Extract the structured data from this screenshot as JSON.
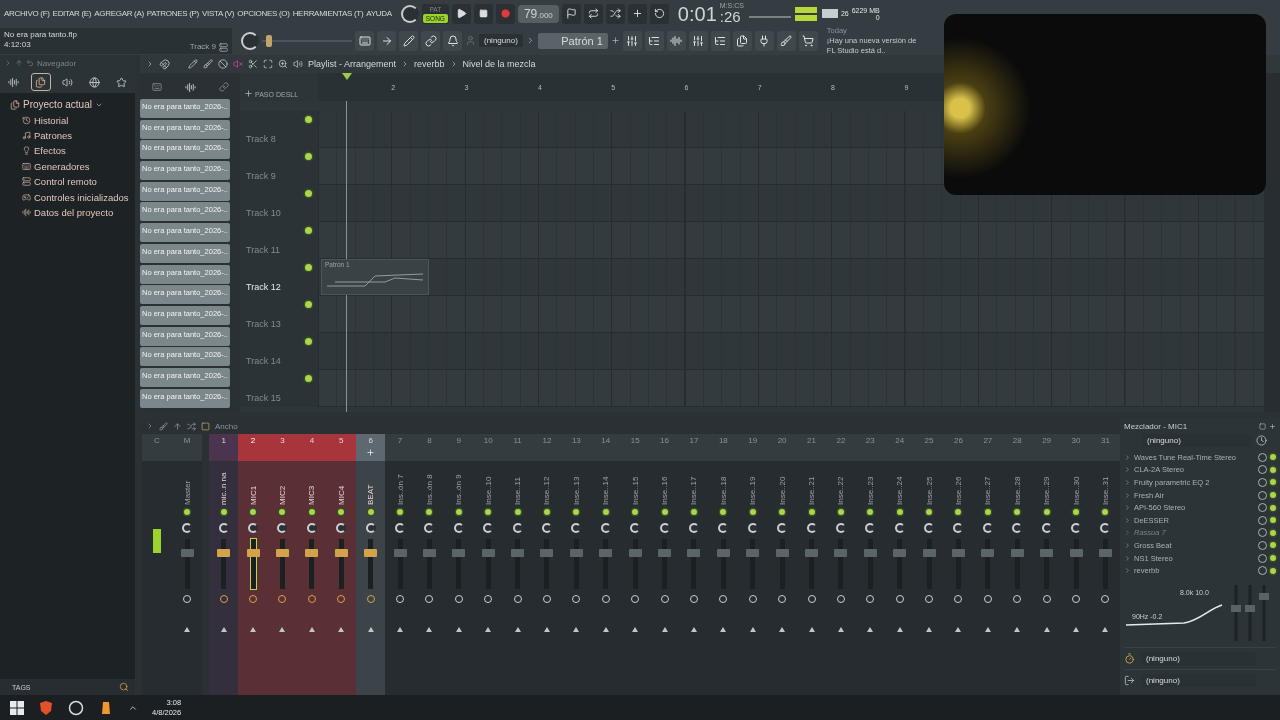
{
  "menu": [
    "ARCHIVO (F)",
    "EDITAR (E)",
    "AGREGAR (A)",
    "PATRONES (P)",
    "VISTA (V)",
    "OPCIONES (O)",
    "HERRAMIENTAS (T)",
    "AYUDA"
  ],
  "transport": {
    "modes": [
      {
        "label": "PAT",
        "selected": false
      },
      {
        "label": "SONG",
        "selected": true
      }
    ],
    "tempo": "79",
    "tempo_fraction": ".000",
    "time": "0:01",
    "time_cs": ":26",
    "time_unit": "M:S:CS"
  },
  "monitor": {
    "cpu": "26",
    "memory": "6229 MB",
    "polyphony": "0"
  },
  "project": {
    "file": "No era para tanto.flp",
    "duration": "4:12:03",
    "track": "Track 9",
    "slider": {
      "level": 0.04
    }
  },
  "pattern": {
    "channel": "(ninguno)",
    "name": "Patrón 1"
  },
  "news": {
    "label": "Today",
    "text": "¡Hay una nueva versión de FL Studio está d.."
  },
  "browser": {
    "title": "Navegador",
    "root": {
      "label": "Proyecto actual",
      "expanded": true,
      "children": [
        {
          "label": "Historial"
        },
        {
          "label": "Patrones"
        },
        {
          "label": "Efectos"
        },
        {
          "label": "Generadores"
        },
        {
          "label": "Control remoto"
        },
        {
          "label": "Controles inicializados"
        },
        {
          "label": "Datos del proyecto"
        }
      ]
    },
    "footer": "TAGS"
  },
  "playlist": {
    "breadcrumb": [
      "Playlist - Arrangement",
      "reverbb",
      "Nivel de la mezcla"
    ],
    "step_label": "PASO",
    "slide_label": "DESLL",
    "clips": [
      "No era para tanto_2026-..",
      "No era para tanto_2026-..",
      "No era para tanto_2026-..",
      "No era para tanto_2026-..",
      "No era para tanto_2026-..",
      "No era para tanto_2026-..",
      "No era para tanto_2026-..",
      "No era para tanto_2026-..",
      "No era para tanto_2026-..",
      "No era para tanto_2026-..",
      "No era para tanto_2026-..",
      "No era para tanto_2026-..",
      "No era para tanto_2026-..",
      "No era para tanto_2026-..",
      "No era para tanto_2026-.."
    ],
    "ruler": [
      "2",
      "3",
      "4",
      "5",
      "6",
      "7",
      "8",
      "9"
    ],
    "tracks": [
      {
        "name": "Track 8",
        "selected": false
      },
      {
        "name": "Track 9",
        "selected": false
      },
      {
        "name": "Track 10",
        "selected": false
      },
      {
        "name": "Track 11",
        "selected": false
      },
      {
        "name": "Track 12",
        "selected": true,
        "clip": {
          "label": "Patrón 1"
        }
      },
      {
        "name": "Track 13",
        "selected": false
      },
      {
        "name": "Track 14",
        "selected": false
      },
      {
        "name": "Track 15",
        "selected": false
      }
    ]
  },
  "mixer": {
    "toolbar_label": "Ancho",
    "channels": [
      {
        "number": "C",
        "kind": "meter",
        "selected": false
      },
      {
        "number": "M",
        "name": "Master",
        "kind": "master",
        "selected": false
      },
      {
        "number": "1",
        "name": "mic..n na",
        "kind": "insert",
        "selected": false,
        "color": "#4a3450"
      },
      {
        "number": "2",
        "name": "MIC1",
        "kind": "insert",
        "selected": true,
        "color": "#a8343c"
      },
      {
        "number": "3",
        "name": "MIC2",
        "kind": "insert",
        "selected": false,
        "color": "#a8343c"
      },
      {
        "number": "4",
        "name": "MIC3",
        "kind": "insert",
        "selected": false,
        "color": "#a8343c"
      },
      {
        "number": "5",
        "name": "MIC4",
        "kind": "insert",
        "selected": false,
        "color": "#a8343c"
      },
      {
        "number": "6",
        "name": "BEAT",
        "kind": "insert",
        "selected": false,
        "color": "#5e6870"
      },
      {
        "number": "7",
        "name": "Ins..ón 7",
        "kind": "insert",
        "selected": false
      },
      {
        "number": "8",
        "name": "Ins..ón 8",
        "kind": "insert",
        "selected": false
      },
      {
        "number": "9",
        "name": "Ins..ón 9",
        "kind": "insert",
        "selected": false
      },
      {
        "number": "10",
        "name": "Inse..10",
        "kind": "insert",
        "selected": false
      },
      {
        "number": "11",
        "name": "Inse..11",
        "kind": "insert",
        "selected": false
      },
      {
        "number": "12",
        "name": "Inse..12",
        "kind": "insert",
        "selected": false
      },
      {
        "number": "13",
        "name": "Inse..13",
        "kind": "insert",
        "selected": false
      },
      {
        "number": "14",
        "name": "Inse..14",
        "kind": "insert",
        "selected": false
      },
      {
        "number": "15",
        "name": "Inse..15",
        "kind": "insert",
        "selected": false
      },
      {
        "number": "16",
        "name": "Inse..16",
        "kind": "insert",
        "selected": false
      },
      {
        "number": "17",
        "name": "Inse..17",
        "kind": "insert",
        "selected": false
      },
      {
        "number": "18",
        "name": "Inse..18",
        "kind": "insert",
        "selected": false
      },
      {
        "number": "19",
        "name": "Inse..19",
        "kind": "insert",
        "selected": false
      },
      {
        "number": "20",
        "name": "Inse..20",
        "kind": "insert",
        "selected": false
      },
      {
        "number": "21",
        "name": "Inse..21",
        "kind": "insert",
        "selected": false
      },
      {
        "number": "22",
        "name": "Inse..22",
        "kind": "insert",
        "selected": false
      },
      {
        "number": "23",
        "name": "Inse..23",
        "kind": "insert",
        "selected": false
      },
      {
        "number": "24",
        "name": "Inse..24",
        "kind": "insert",
        "selected": false
      },
      {
        "number": "25",
        "name": "Inse..25",
        "kind": "insert",
        "selected": false
      },
      {
        "number": "26",
        "name": "Inse..26",
        "kind": "insert",
        "selected": false
      },
      {
        "number": "27",
        "name": "Inse..27",
        "kind": "insert",
        "selected": false
      },
      {
        "number": "28",
        "name": "Inse..28",
        "kind": "insert",
        "selected": false
      },
      {
        "number": "29",
        "name": "Inse..29",
        "kind": "insert",
        "selected": false
      },
      {
        "number": "30",
        "name": "Inse..30",
        "kind": "insert",
        "selected": false
      },
      {
        "number": "31",
        "name": "Inse..31",
        "kind": "insert",
        "selected": false
      }
    ]
  },
  "mixer_panel": {
    "title": "Mezclador - MIC1",
    "input": "(ninguno)",
    "slots": [
      {
        "name": "Waves Tune Real-Time Stereo",
        "on": true,
        "disabled": false
      },
      {
        "name": "CLA-2A Stereo",
        "on": true,
        "disabled": false
      },
      {
        "name": "Fruity parametric EQ 2",
        "on": true,
        "disabled": false
      },
      {
        "name": "Fresh Air",
        "on": true,
        "disabled": false
      },
      {
        "name": "API-560 Stereo",
        "on": true,
        "disabled": false
      },
      {
        "name": "DeESSER",
        "on": true,
        "disabled": false
      },
      {
        "name": "Rassua 7",
        "on": true,
        "disabled": true
      },
      {
        "name": "Gross Beat",
        "on": true,
        "disabled": false
      },
      {
        "name": "NS1 Stereo",
        "on": true,
        "disabled": false
      },
      {
        "name": "reverbb",
        "on": true,
        "disabled": false
      }
    ],
    "eq_labels": [
      "8.0k 10.0",
      "90Hz -0.2"
    ],
    "sends": [
      "(ninguno)",
      "(ninguno)"
    ]
  },
  "taskbar": {
    "time": "3:08",
    "date": "4/8/2026"
  }
}
